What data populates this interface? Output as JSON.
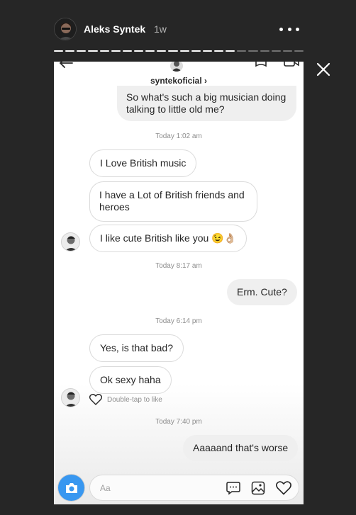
{
  "story": {
    "username": "Aleks Syntek",
    "age": "1w",
    "segments_total": 22,
    "segments_done": 16
  },
  "chat": {
    "contact_name": "syntekoficial",
    "contact_chevron": "›",
    "messages": [
      {
        "id": "m1",
        "text": "So what's such a big musician doing talking to little old me?",
        "direction": "outgoing"
      },
      {
        "id": "s1",
        "stamp": "Today 1:02 am"
      },
      {
        "id": "m2",
        "text": "I Love British music",
        "direction": "incoming"
      },
      {
        "id": "m3",
        "text": "I have  a Lot of British friends and heroes",
        "direction": "incoming"
      },
      {
        "id": "m4",
        "text": "I like cute British like you 😉👌🏼",
        "direction": "incoming"
      },
      {
        "id": "s2",
        "stamp": "Today 8:17 am"
      },
      {
        "id": "m5",
        "text": "Erm.  Cute?",
        "direction": "outgoing"
      },
      {
        "id": "s3",
        "stamp": "Today 6:14 pm"
      },
      {
        "id": "m6",
        "text": "Yes, is that bad?",
        "direction": "incoming"
      },
      {
        "id": "m7",
        "text": "Ok sexy haha",
        "direction": "incoming"
      },
      {
        "id": "s4",
        "stamp": "Today 7:40 pm"
      },
      {
        "id": "m8",
        "text": "Aaaaand that's worse",
        "direction": "outgoing"
      }
    ],
    "like_hint": "Double-tap to like"
  },
  "composer": {
    "placeholder": "Aa"
  },
  "icons": {
    "more": "more-options-icon",
    "close": "close-icon",
    "back": "back-arrow-icon",
    "flag": "flag-icon",
    "video": "video-call-icon",
    "camera": "camera-icon",
    "message": "message-icon",
    "gallery": "gallery-icon",
    "heart": "heart-icon"
  },
  "colors": {
    "background": "#262626",
    "accent": "#3897f0",
    "bubble_out": "#efefef",
    "bubble_border": "#dbdbdb"
  }
}
